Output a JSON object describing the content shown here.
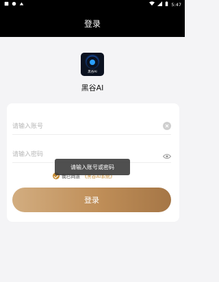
{
  "status_bar": {
    "time": "5:47"
  },
  "app_bar": {
    "title": "登录"
  },
  "brand": {
    "logo_text": "黑谷AI",
    "name": "黑谷AI"
  },
  "form": {
    "account_placeholder": "请输入账号",
    "password_placeholder": "请输入密码",
    "agreement_prefix": "我已同意",
    "agreement_link": "《黑谷AI系统》",
    "login_label": "登录"
  },
  "toast": {
    "message": "请输入账号或密码"
  },
  "colors": {
    "accent": "#c58a32",
    "app_bar": "#000000"
  }
}
